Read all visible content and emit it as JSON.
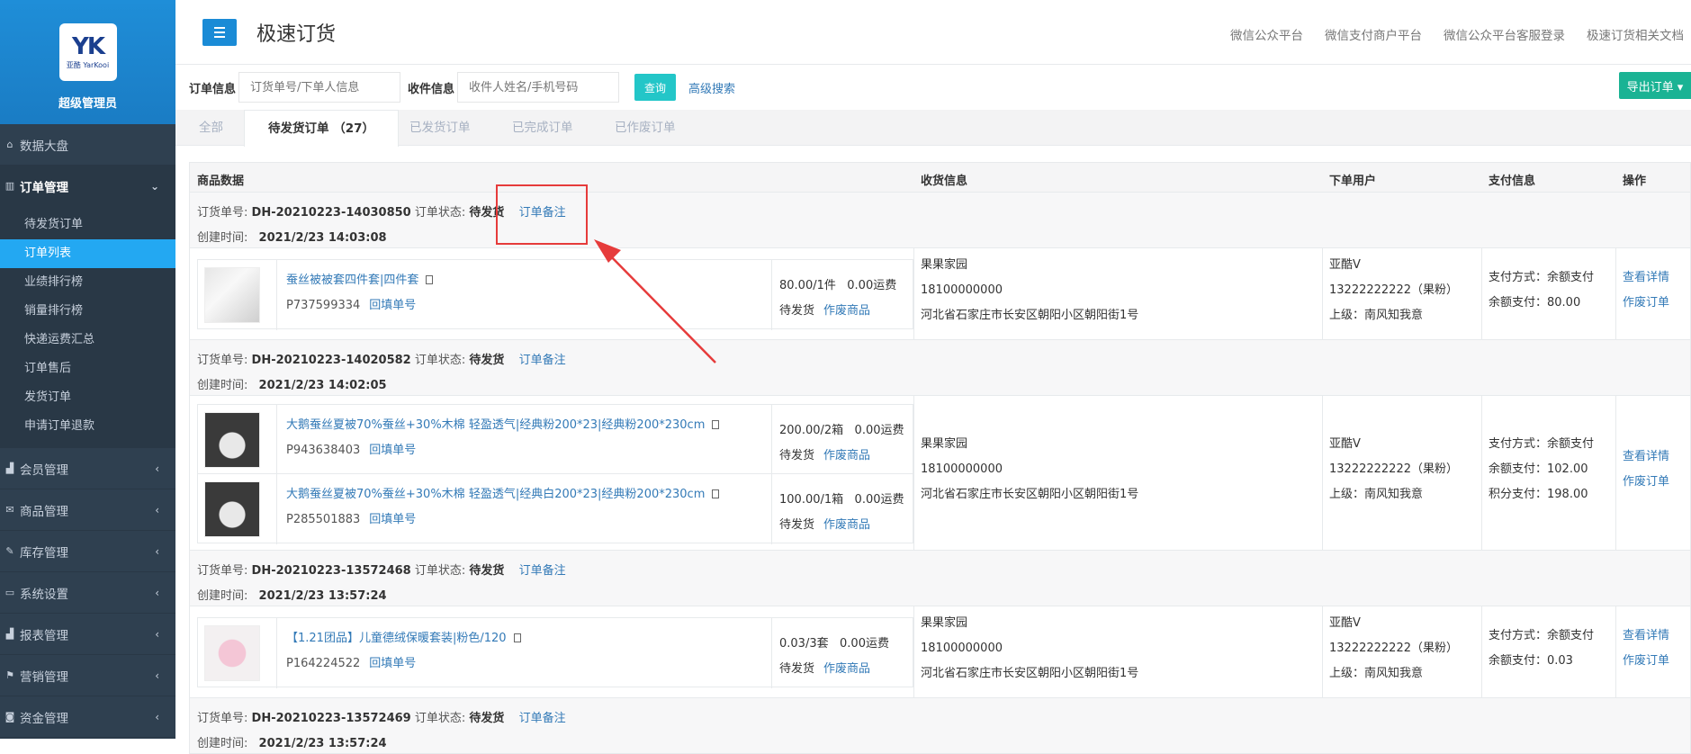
{
  "sidebar": {
    "logo_text": "YK",
    "logo_sub": "亚酷 YarKooi",
    "role": "超级管理员",
    "items": [
      {
        "label": "数据大盘",
        "icon": "home-icon"
      },
      {
        "label": "订单管理",
        "icon": "order-icon",
        "open": true
      },
      {
        "label": "会员管理",
        "icon": "chart-icon"
      },
      {
        "label": "商品管理",
        "icon": "mail-icon"
      },
      {
        "label": "库存管理",
        "icon": "edit-icon"
      },
      {
        "label": "系统设置",
        "icon": "monitor-icon"
      },
      {
        "label": "报表管理",
        "icon": "bar-chart-icon"
      },
      {
        "label": "营销管理",
        "icon": "flag-icon"
      },
      {
        "label": "资金管理",
        "icon": "money-icon"
      }
    ],
    "sub_items": [
      "待发货订单",
      "订单列表",
      "业绩排行榜",
      "销量排行榜",
      "快递运费汇总",
      "订单售后",
      "发货订单",
      "申请订单退款"
    ],
    "active_sub": "订单列表"
  },
  "header": {
    "title": "极速订货",
    "links": [
      "微信公众平台",
      "微信支付商户平台",
      "微信公众平台客服登录",
      "极速订货相关文档"
    ]
  },
  "filter": {
    "order_label": "订单信息",
    "order_placeholder": "订货单号/下单人信息",
    "receiver_label": "收件信息",
    "receiver_placeholder": "收件人姓名/手机号码",
    "query_label": "查询",
    "advanced_label": "高级搜索",
    "export_label": "导出订单 ▾"
  },
  "tabs": [
    "全部",
    "待发货订单 （27）",
    "已发货订单",
    "已完成订单",
    "已作废订单"
  ],
  "columns": [
    "商品数据",
    "收货信息",
    "下单用户",
    "支付信息",
    "操作"
  ],
  "labels": {
    "order_no": "订货单号:",
    "order_status": "订单状态:",
    "created": "创建时间:",
    "remark": "订单备注",
    "backfill": "回填单号",
    "pending": "待发货",
    "void_item": "作废商品",
    "view_detail": "查看详情",
    "void_order": "作废订单"
  },
  "orders": [
    {
      "no": "DH-20210223-14030850",
      "status": "待发货",
      "created": "2021/2/23 14:03:08",
      "products": [
        {
          "name": "蚕丝被被套四件套|四件套",
          "code": "P737599334",
          "price": "80.00/1件",
          "freight": "0.00运费"
        }
      ],
      "receiver": {
        "name": "果果家园",
        "phone": "18100000000",
        "address": "河北省石家庄市长安区朝阳小区朝阳街1号"
      },
      "user": {
        "name": "亚酷V",
        "phone": "13222222222（果粉）",
        "superior": "上级：南风知我意"
      },
      "payment": [
        "支付方式：余额支付",
        "余额支付：80.00"
      ]
    },
    {
      "no": "DH-20210223-14020582",
      "status": "待发货",
      "created": "2021/2/23 14:02:05",
      "products": [
        {
          "name": "大鹅蚕丝夏被70%蚕丝+30%木棉 轻盈透气|经典粉200*23|经典粉200*230cm",
          "code": "P943638403",
          "price": "200.00/2箱",
          "freight": "0.00运费"
        },
        {
          "name": "大鹅蚕丝夏被70%蚕丝+30%木棉 轻盈透气|经典白200*23|经典粉200*230cm",
          "code": "P285501883",
          "price": "100.00/1箱",
          "freight": "0.00运费"
        }
      ],
      "receiver": {
        "name": "果果家园",
        "phone": "18100000000",
        "address": "河北省石家庄市长安区朝阳小区朝阳街1号"
      },
      "user": {
        "name": "亚酷V",
        "phone": "13222222222（果粉）",
        "superior": "上级：南风知我意"
      },
      "payment": [
        "支付方式：余额支付",
        "余额支付：102.00",
        "积分支付：198.00"
      ]
    },
    {
      "no": "DH-20210223-13572468",
      "status": "待发货",
      "created": "2021/2/23 13:57:24",
      "products": [
        {
          "name": "【1.21团品】儿童德绒保暖套装|粉色/120",
          "code": "P164224522",
          "price": "0.03/3套",
          "freight": "0.00运费"
        }
      ],
      "receiver": {
        "name": "果果家园",
        "phone": "18100000000",
        "address": "河北省石家庄市长安区朝阳小区朝阳街1号"
      },
      "user": {
        "name": "亚酷V",
        "phone": "13222222222（果粉）",
        "superior": "上级：南风知我意"
      },
      "payment": [
        "支付方式：余额支付",
        "余额支付：0.03"
      ]
    },
    {
      "no": "DH-20210223-13572469",
      "status": "待发货",
      "created": "2021/2/23 13:57:24"
    }
  ]
}
